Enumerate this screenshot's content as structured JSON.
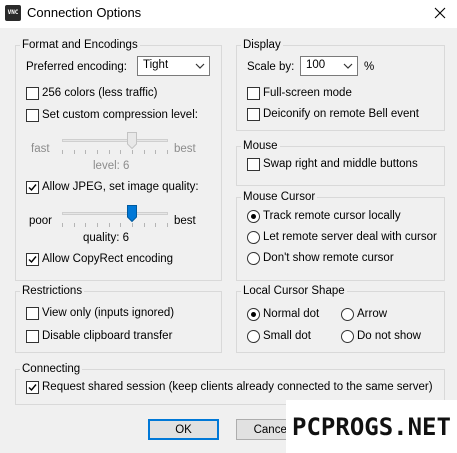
{
  "window": {
    "title": "Connection Options",
    "icon": "vnc-app-icon",
    "icon_text": "VNC"
  },
  "format": {
    "group_label": "Format and Encodings",
    "preferred_encoding_label": "Preferred encoding:",
    "preferred_encoding_value": "Tight",
    "colors_256": {
      "label": "256 colors (less traffic)",
      "checked": false
    },
    "custom_compression": {
      "label": "Set custom compression level:",
      "checked": false
    },
    "compression_slider": {
      "left_label": "fast",
      "right_label": "best",
      "value_label": "level: 6",
      "value": 6,
      "max": 9,
      "enabled": false
    },
    "allow_jpeg": {
      "label": "Allow JPEG, set image quality:",
      "checked": true
    },
    "quality_slider": {
      "left_label": "poor",
      "right_label": "best",
      "value_label": "quality: 6",
      "value": 6,
      "max": 9,
      "enabled": true
    },
    "copyrect": {
      "label": "Allow CopyRect encoding",
      "checked": true
    }
  },
  "display": {
    "group_label": "Display",
    "scale_label": "Scale by:",
    "scale_value": "100",
    "scale_unit": "%",
    "fullscreen": {
      "label": "Full-screen mode",
      "checked": false
    },
    "deiconify": {
      "label": "Deiconify on remote Bell event",
      "checked": false
    }
  },
  "mouse": {
    "group_label": "Mouse",
    "swap": {
      "label": "Swap right and middle buttons",
      "checked": false
    }
  },
  "mouse_cursor": {
    "group_label": "Mouse Cursor",
    "options": [
      {
        "label": "Track remote cursor locally",
        "selected": true
      },
      {
        "label": "Let remote server deal with cursor",
        "selected": false
      },
      {
        "label": "Don't show remote cursor",
        "selected": false
      }
    ]
  },
  "restrictions": {
    "group_label": "Restrictions",
    "view_only": {
      "label": "View only (inputs ignored)",
      "checked": false
    },
    "disable_clipboard": {
      "label": "Disable clipboard transfer",
      "checked": false
    }
  },
  "local_cursor": {
    "group_label": "Local Cursor Shape",
    "options": [
      {
        "label": "Normal dot",
        "selected": true
      },
      {
        "label": "Arrow",
        "selected": false
      },
      {
        "label": "Small dot",
        "selected": false
      },
      {
        "label": "Do not show",
        "selected": false
      }
    ]
  },
  "connecting": {
    "group_label": "Connecting",
    "shared": {
      "label": "Request shared session (keep clients already connected to the same server)",
      "checked": true
    }
  },
  "buttons": {
    "ok": "OK",
    "cancel": "Cancel"
  },
  "watermark": "PCPROGS.NET",
  "colors": {
    "dialog_bg": "#f0f0f0",
    "group_border": "#d9d9d9",
    "default_button_border": "#0078d7",
    "slider_thumb_active": "#0078d7",
    "disabled_text": "#8c8c8c"
  }
}
